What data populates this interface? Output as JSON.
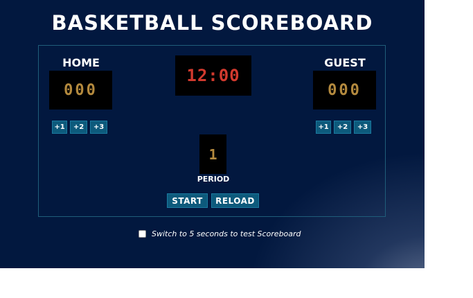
{
  "app": {
    "title": "BASKETBALL SCOREBOARD"
  },
  "home": {
    "label": "HOME",
    "score": "000",
    "buttons": [
      "+1",
      "+2",
      "+3"
    ]
  },
  "guest": {
    "label": "GUEST",
    "score": "000",
    "buttons": [
      "+1",
      "+2",
      "+3"
    ]
  },
  "clock": {
    "time": "12:00"
  },
  "period": {
    "value": "1",
    "label": "PERIOD"
  },
  "controls": {
    "start_label": "START",
    "reload_label": "RELOAD"
  },
  "test_mode": {
    "checked": false,
    "label": "Switch to 5 seconds to test Scoreboard"
  },
  "colors": {
    "background": "#02183f",
    "button": "#0d5a7c",
    "score_digits": "#b48a3e",
    "clock_digits": "#d23a2e"
  }
}
